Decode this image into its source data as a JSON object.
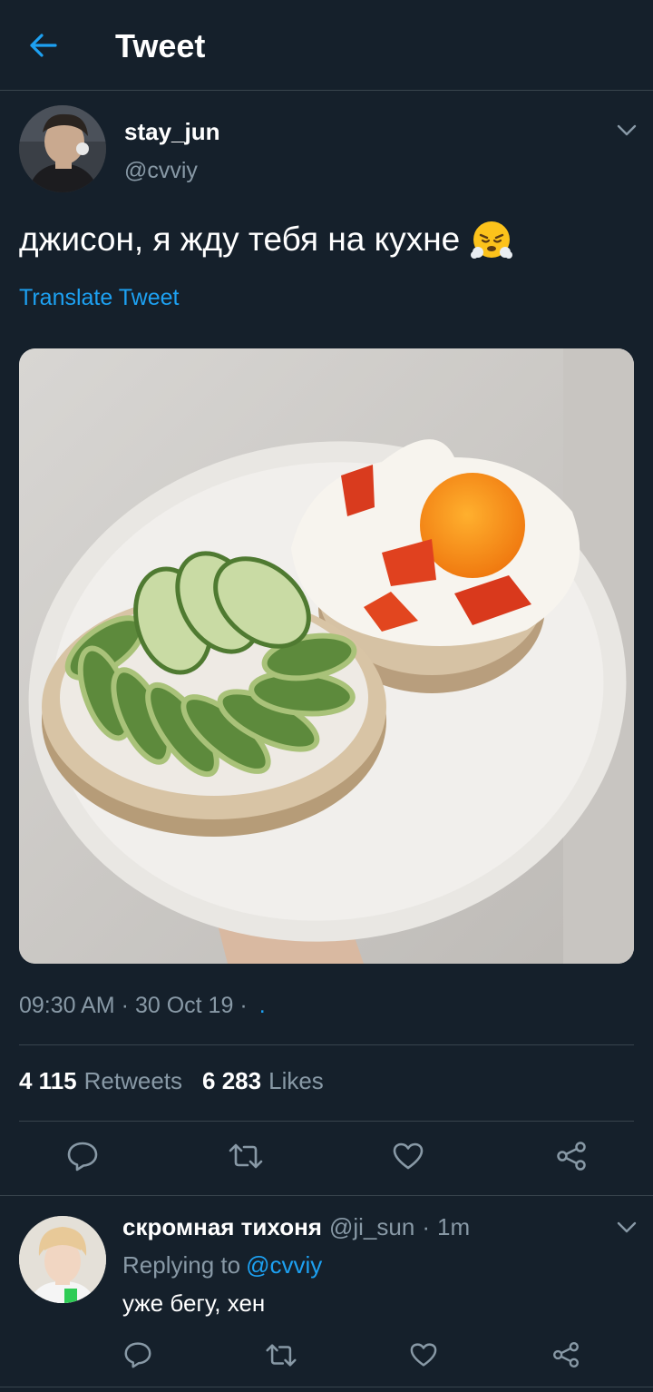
{
  "header": {
    "title": "Tweet",
    "back_icon": "arrow-left-icon"
  },
  "tweet": {
    "author_name": "stay_jun",
    "author_handle": "@cvviy",
    "text": "джисон, я жду тебя на кухне",
    "emoji": "face-with-steam-from-nose",
    "translate_label": "Translate Tweet",
    "photo_alt": "",
    "time": "09:30 AM",
    "date": "30 Oct 19",
    "source": ".",
    "retweets_count": "4 115",
    "retweets_label": "Retweets",
    "likes_count": "6 283",
    "likes_label": "Likes"
  },
  "actions": [
    "reply-icon",
    "retweet-icon",
    "like-icon",
    "share-icon"
  ],
  "reply": {
    "author_name": "скромная тихоня",
    "author_handle": "@ji_sun",
    "separator": "·",
    "time": "1m",
    "replying_prefix": "Replying to",
    "replying_to": "@cvviy",
    "text": "уже бегу, хен"
  },
  "colors": {
    "background": "#15202b",
    "accent": "#1da1f2",
    "muted": "#8899a6",
    "border": "#38444d"
  }
}
